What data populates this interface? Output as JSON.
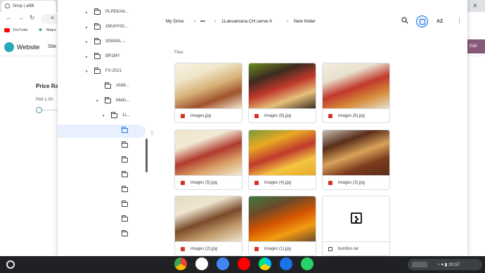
{
  "browser": {
    "tab_title": "Shop | allllll",
    "omnibox": "al",
    "bookmarks": [
      "YouTube",
      "Maps"
    ],
    "site_title": "Website",
    "site_nav": "Site",
    "edit_label": "Edit",
    "price_title": "Price Ra",
    "price_min": "RM 1.00"
  },
  "picker": {
    "tree": [
      {
        "label": "PLPEKAN...",
        "arrow": "▸"
      },
      {
        "label": "2MUHYID...",
        "arrow": "▸"
      },
      {
        "label": "3ISMAIL ...",
        "arrow": "▸"
      },
      {
        "label": "BR1MY",
        "arrow": "▸"
      },
      {
        "label": "FX-2021",
        "arrow": "▾"
      },
      {
        "label": "ANW...",
        "arrow": ""
      },
      {
        "label": "Mello...",
        "arrow": "▾"
      },
      {
        "label": "1L...",
        "arrow": "▾"
      },
      {
        "label": "",
        "arrow": ""
      },
      {
        "label": "",
        "arrow": ""
      },
      {
        "label": "",
        "arrow": ""
      },
      {
        "label": "",
        "arrow": ""
      },
      {
        "label": "",
        "arrow": ""
      },
      {
        "label": "",
        "arrow": ""
      },
      {
        "label": "",
        "arrow": ""
      },
      {
        "label": "",
        "arrow": ""
      }
    ],
    "breadcrumb": {
      "root": "My Drive",
      "more": "•••",
      "parent": "1Laksamana CH.serve-II",
      "current": "New folder"
    },
    "sort_label": "AZ",
    "files_label": "Files",
    "files": [
      {
        "name": "images.jpg",
        "type": "image"
      },
      {
        "name": "images (8).jpg",
        "type": "image"
      },
      {
        "name": "images (6).jpg",
        "type": "image"
      },
      {
        "name": "images (5).jpg",
        "type": "image"
      },
      {
        "name": "images (4).jpg",
        "type": "image"
      },
      {
        "name": "images (3).jpg",
        "type": "image"
      },
      {
        "name": "images (2).jpg",
        "type": "image"
      },
      {
        "name": "images (1).jpg",
        "type": "image"
      },
      {
        "name": "burritos.rar",
        "type": "archive"
      }
    ]
  },
  "shelf": {
    "time": "20:57",
    "apps": [
      "chrome-icon",
      "gmail-icon",
      "docs-icon",
      "youtube-icon",
      "play-store-icon",
      "files-icon",
      "whatsapp-icon"
    ]
  },
  "colors": {
    "accent": "#1a73e8",
    "shelf": "#202124",
    "selected_row": "#e8f0fe"
  }
}
